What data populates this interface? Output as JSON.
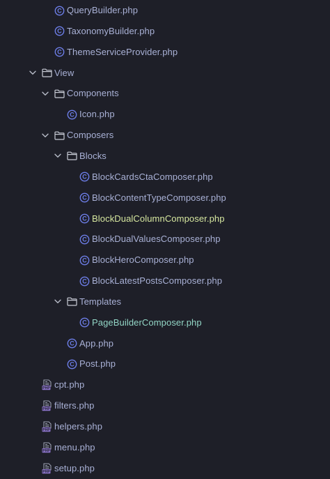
{
  "colors": {
    "background": "#1e1f28",
    "text_default": "#a9b1d6",
    "text_highlight": "#d7e8a0",
    "text_modified": "#93d6c6",
    "class_icon": "#6d7ee8",
    "folder_icon": "#c9ccd6",
    "php_icon": "#8a72c8"
  },
  "tree": [
    {
      "label": "QueryBuilder.php",
      "icon": "class-icon",
      "depth": 3,
      "state": "default"
    },
    {
      "label": "TaxonomyBuilder.php",
      "icon": "class-icon",
      "depth": 3,
      "state": "default"
    },
    {
      "label": "ThemeServiceProvider.php",
      "icon": "class-icon",
      "depth": 3,
      "state": "default"
    },
    {
      "label": "View",
      "icon": "folder-icon",
      "depth": 2,
      "expanded": true,
      "state": "default"
    },
    {
      "label": "Components",
      "icon": "folder-icon",
      "depth": 3,
      "expanded": true,
      "state": "default"
    },
    {
      "label": "Icon.php",
      "icon": "class-icon",
      "depth": 4,
      "state": "default"
    },
    {
      "label": "Composers",
      "icon": "folder-icon",
      "depth": 3,
      "expanded": true,
      "state": "default"
    },
    {
      "label": "Blocks",
      "icon": "folder-icon",
      "depth": 4,
      "expanded": true,
      "state": "default"
    },
    {
      "label": "BlockCardsCtaComposer.php",
      "icon": "class-icon",
      "depth": 5,
      "state": "default"
    },
    {
      "label": "BlockContentTypeComposer.php",
      "icon": "class-icon",
      "depth": 5,
      "state": "default"
    },
    {
      "label": "BlockDualColumnComposer.php",
      "icon": "class-icon",
      "depth": 5,
      "state": "highlight"
    },
    {
      "label": "BlockDualValuesComposer.php",
      "icon": "class-icon",
      "depth": 5,
      "state": "default"
    },
    {
      "label": "BlockHeroComposer.php",
      "icon": "class-icon",
      "depth": 5,
      "state": "default"
    },
    {
      "label": "BlockLatestPostsComposer.php",
      "icon": "class-icon",
      "depth": 5,
      "state": "default"
    },
    {
      "label": "Templates",
      "icon": "folder-icon",
      "depth": 4,
      "expanded": true,
      "state": "default"
    },
    {
      "label": "PageBuilderComposer.php",
      "icon": "class-icon",
      "depth": 5,
      "state": "modified"
    },
    {
      "label": "App.php",
      "icon": "class-icon",
      "depth": 4,
      "state": "default"
    },
    {
      "label": "Post.php",
      "icon": "class-icon",
      "depth": 4,
      "state": "default"
    },
    {
      "label": "cpt.php",
      "icon": "php-icon",
      "depth": 2,
      "state": "default"
    },
    {
      "label": "filters.php",
      "icon": "php-icon",
      "depth": 2,
      "state": "default"
    },
    {
      "label": "helpers.php",
      "icon": "php-icon",
      "depth": 2,
      "state": "default"
    },
    {
      "label": "menu.php",
      "icon": "php-icon",
      "depth": 2,
      "state": "default"
    },
    {
      "label": "setup.php",
      "icon": "php-icon",
      "depth": 2,
      "state": "default"
    }
  ]
}
